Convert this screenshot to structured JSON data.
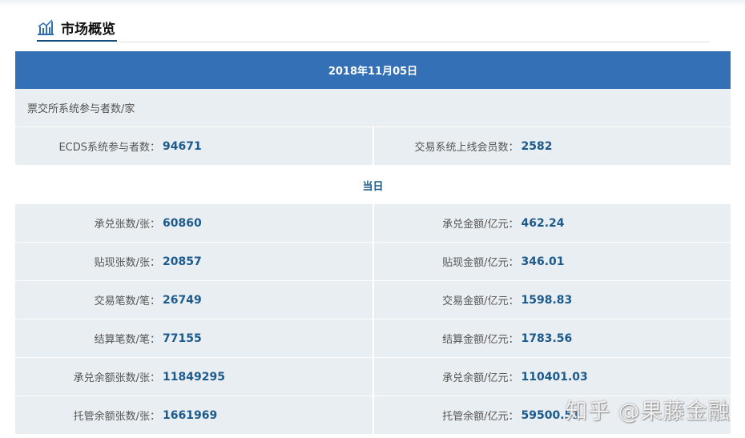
{
  "header": {
    "title": "市场概览",
    "icon": "bar-chart-icon"
  },
  "date": "2018年11月05日",
  "participants": {
    "section": "票交所系统参与者数/家",
    "items": [
      {
        "label": "ECDS系统参与者数：",
        "value": "94671"
      },
      {
        "label": "交易系统上线会员数：",
        "value": "2582"
      }
    ]
  },
  "today": {
    "label": "当日",
    "rows": [
      [
        {
          "label": "承兑张数/张：",
          "value": "60860"
        },
        {
          "label": "承兑金额/亿元：",
          "value": "462.24"
        }
      ],
      [
        {
          "label": "贴现张数/张：",
          "value": "20857"
        },
        {
          "label": "贴现金额/亿元：",
          "value": "346.01"
        }
      ],
      [
        {
          "label": "交易笔数/笔：",
          "value": "26749"
        },
        {
          "label": "交易金额/亿元：",
          "value": "1598.83"
        }
      ],
      [
        {
          "label": "结算笔数/笔：",
          "value": "77155"
        },
        {
          "label": "结算金额/亿元：",
          "value": "1783.56"
        }
      ],
      [
        {
          "label": "承兑余额张数/张：",
          "value": "11849295"
        },
        {
          "label": "承兑余额/亿元：",
          "value": "110401.03"
        }
      ],
      [
        {
          "label": "托管余额张数/张：",
          "value": "1661969"
        },
        {
          "label": "托管余额/亿元：",
          "value": "59500.51"
        }
      ]
    ]
  },
  "watermark": "知乎 @果藤金融",
  "colors": {
    "header": "#3370b5",
    "value": "#1d5a8c",
    "row": "#e9eef2"
  }
}
